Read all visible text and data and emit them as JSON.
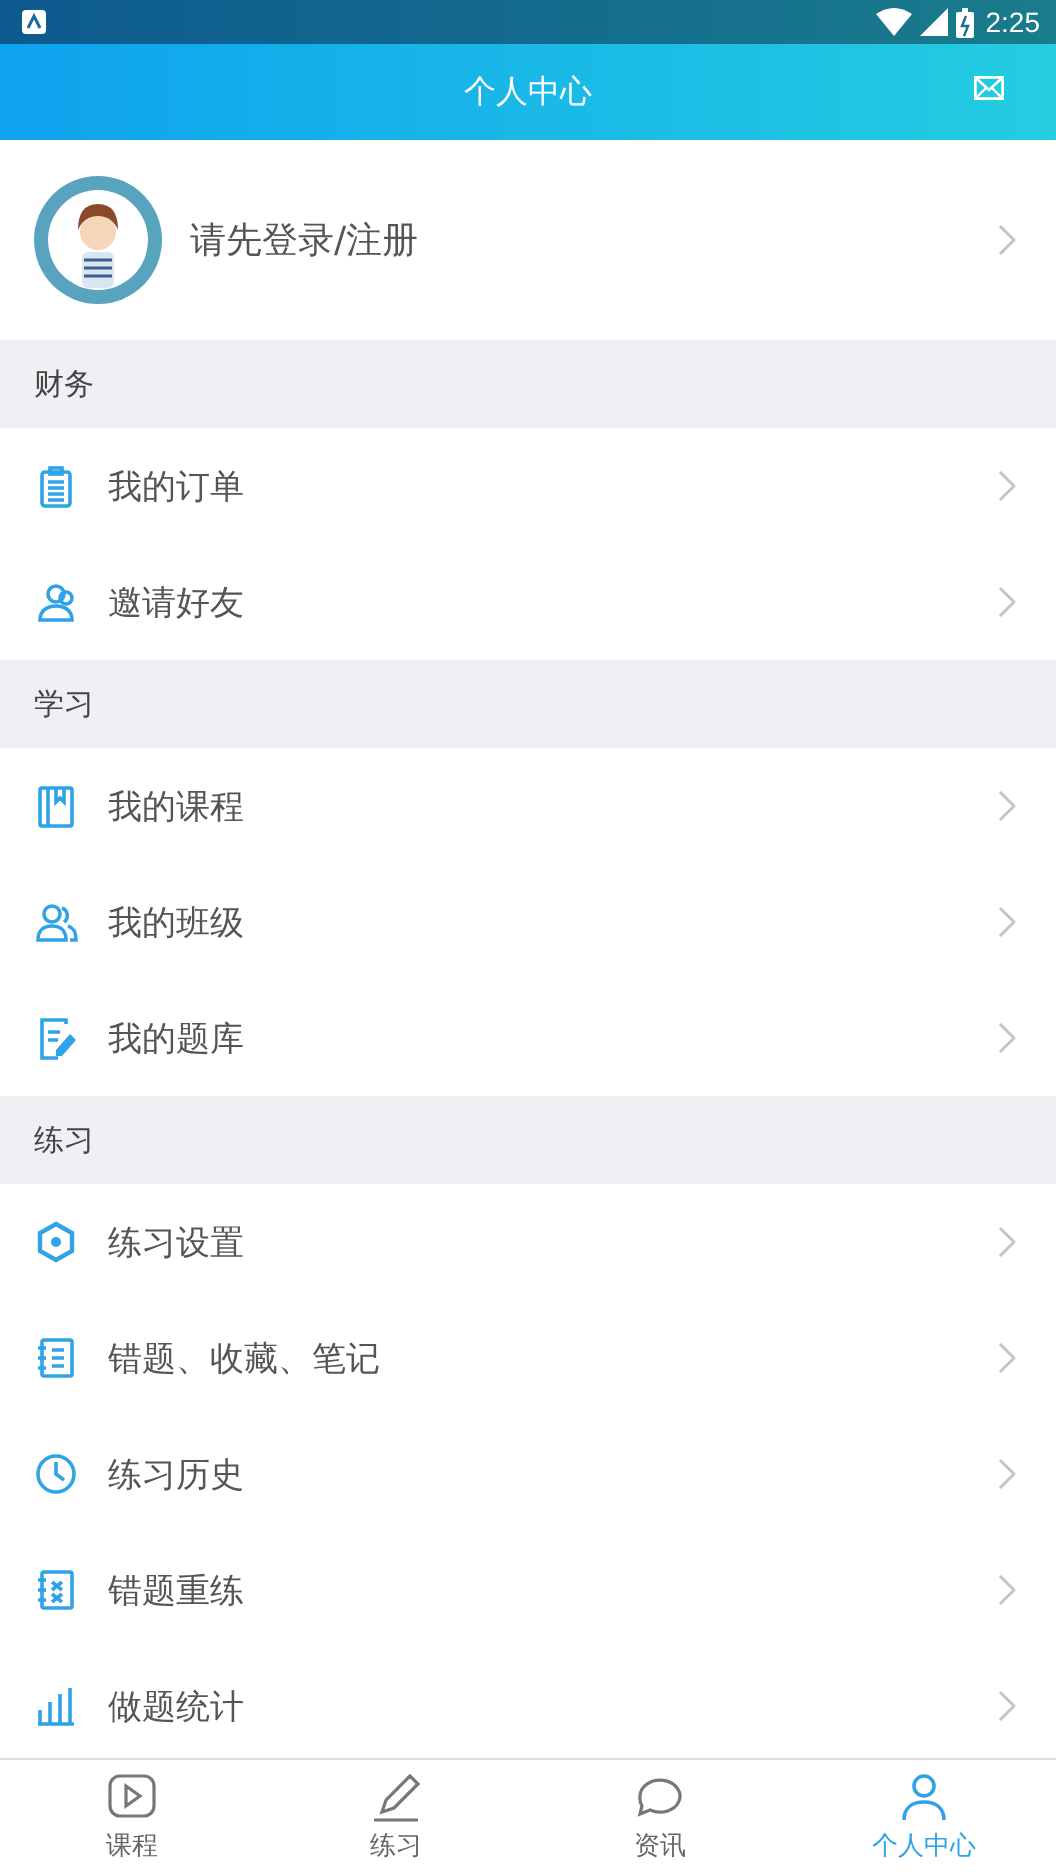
{
  "status_bar": {
    "time": "2:25"
  },
  "header": {
    "title": "个人中心"
  },
  "profile": {
    "label": "请先登录/注册"
  },
  "sections": [
    {
      "title": "财务",
      "items": [
        {
          "label": "我的订单"
        },
        {
          "label": "邀请好友"
        }
      ]
    },
    {
      "title": "学习",
      "items": [
        {
          "label": "我的课程"
        },
        {
          "label": "我的班级"
        },
        {
          "label": "我的题库"
        }
      ]
    },
    {
      "title": "练习",
      "items": [
        {
          "label": "练习设置"
        },
        {
          "label": "错题、收藏、笔记"
        },
        {
          "label": "练习历史"
        },
        {
          "label": "错题重练"
        },
        {
          "label": "做题统计"
        }
      ]
    }
  ],
  "tabs": [
    {
      "label": "课程",
      "selected": false
    },
    {
      "label": "练习",
      "selected": false
    },
    {
      "label": "资讯",
      "selected": false
    },
    {
      "label": "个人中心",
      "selected": true
    }
  ]
}
